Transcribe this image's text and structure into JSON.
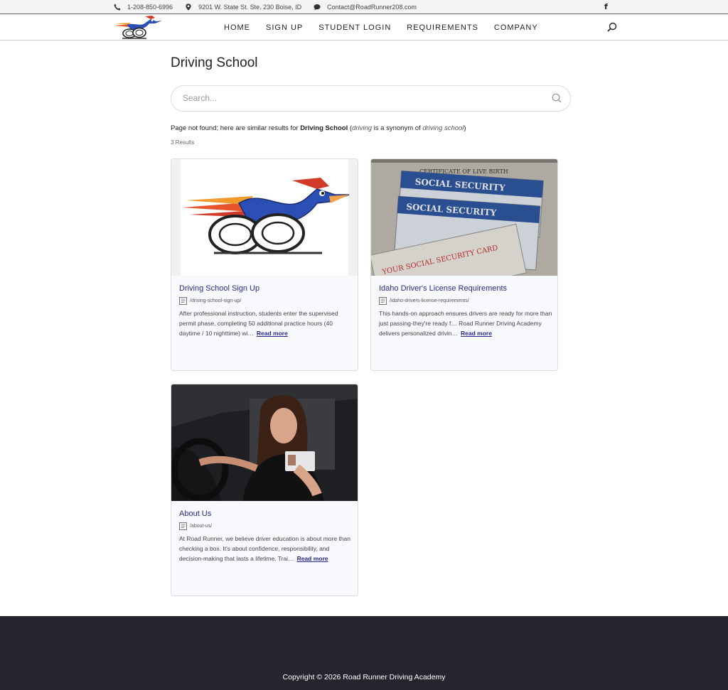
{
  "topbar": {
    "phone": "1-208-850-6996",
    "address": "9201 W. State St. Ste. 230 Boise, ID",
    "email": "Contact@RoadRunner208.com",
    "social": "f"
  },
  "nav": {
    "items": [
      "HOME",
      "SIGN UP",
      "STUDENT LOGIN",
      "REQUIREMENTS",
      "COMPANY"
    ]
  },
  "page": {
    "title": "Driving School",
    "search_placeholder": "Search...",
    "notice_prefix": "Page not found; here are similar results for ",
    "notice_query": "Driving School",
    "notice_open": " (",
    "notice_word": "driving",
    "notice_mid": " is a synonym of ",
    "notice_syn": "driving school",
    "notice_close": ")",
    "results_count": "3 Results"
  },
  "results": [
    {
      "title": "Driving School Sign Up",
      "url": "/driving-school-sign-up/",
      "excerpt": "After professional instruction, students enter the supervised permit phase, completing 50 additional practice hours (40 daytime / 10 nighttime) wi…",
      "read_more": "Read more"
    },
    {
      "title": "Idaho Driver's License Requirements",
      "url": "/idaho-drivers-license-requirements/",
      "excerpt": "This hands-on approach ensures drivers are ready for more than just passing-they're ready f… Road Runner Driving Academy delivers personalized drivin…",
      "read_more": "Read more",
      "image_text": {
        "certificate": "CERTIFICATE OF LIVE BIRTH",
        "ss1": "SOCIAL SECURITY",
        "ss2": "SOCIAL SECURITY",
        "card": "YOUR SOCIAL SECURITY CARD"
      }
    },
    {
      "title": "About Us",
      "url": "/about-us/",
      "excerpt": "At Road Runner, we believe driver education is about more than checking a box. It's about confidence, responsibility, and decision-making that lasts a lifetime. Trai…",
      "read_more": "Read more"
    }
  ],
  "footer": {
    "copyright": "Copyright © 2026 Road Runner Driving Academy"
  },
  "colors": {
    "link": "#2a2a8c",
    "footer_bg": "#25262d"
  }
}
